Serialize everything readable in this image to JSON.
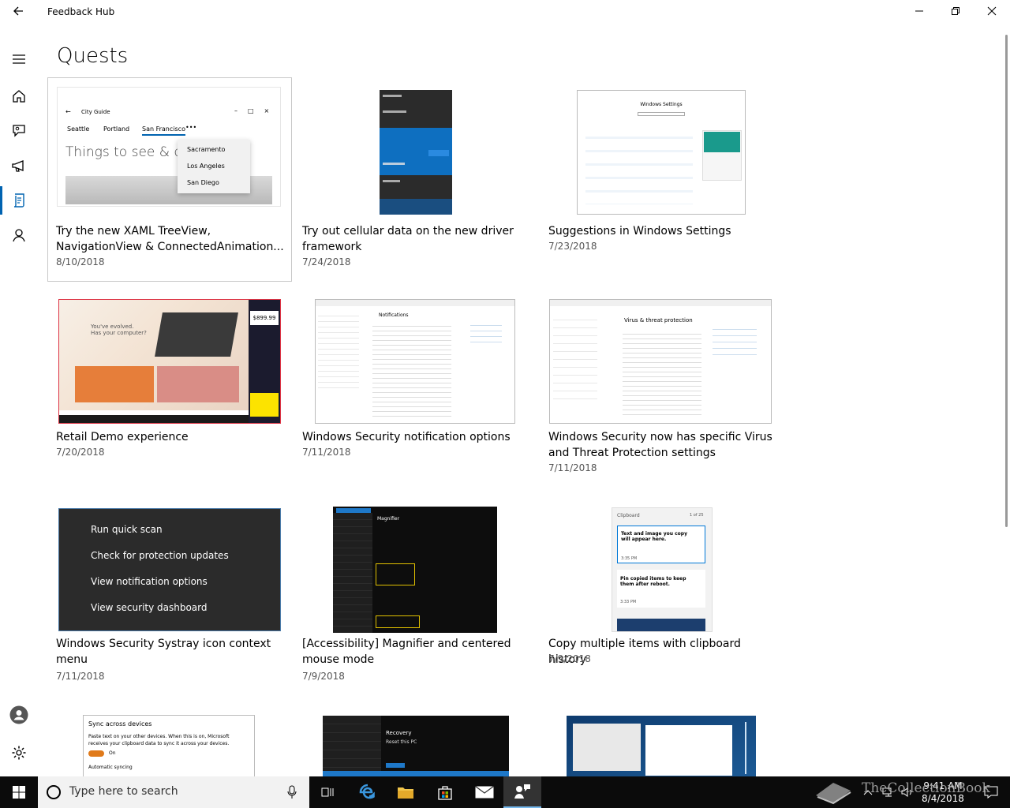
{
  "app": {
    "title": "Feedback Hub",
    "page_title": "Quests"
  },
  "cards": [
    {
      "title": "Try the new XAML TreeView, NavigationView & ConnectedAnimation...",
      "date": "8/10/2018",
      "thumb": {
        "window_title": "City Guide",
        "tabs": [
          "Seattle",
          "Portland",
          "San Francisco"
        ],
        "headline": "Things to see & do",
        "menu": [
          "Sacramento",
          "Los Angeles",
          "San Diego"
        ]
      }
    },
    {
      "title": "Try out cellular data on the new driver framework",
      "date": "7/24/2018"
    },
    {
      "title": "Suggestions in Windows Settings",
      "date": "7/23/2018",
      "thumb": {
        "heading": "Windows Settings"
      }
    },
    {
      "title": "Retail Demo experience",
      "date": "7/20/2018",
      "thumb": {
        "price": "$899.99",
        "tagline1": "You've evolved.",
        "tagline2": "Has your computer?"
      }
    },
    {
      "title": "Windows Security notification options",
      "date": "7/11/2018",
      "thumb": {
        "heading": "Notifications"
      }
    },
    {
      "title": "Windows Security now has specific Virus and Threat Protection settings",
      "date": "7/11/2018",
      "thumb": {
        "heading": "Virus & threat protection"
      }
    },
    {
      "title": "Windows Security Systray icon context menu",
      "date": "7/11/2018",
      "thumb": {
        "menu": [
          "Run quick scan",
          "Check for protection updates",
          "View notification options",
          "View security dashboard"
        ]
      }
    },
    {
      "title": " [Accessibility] Magnifier and centered mouse mode",
      "date": "7/9/2018",
      "thumb": {
        "heading": "Magnifier"
      }
    },
    {
      "title": "Copy multiple items with clipboard history",
      "date": "7/9/2018",
      "thumb": {
        "label": "Clipboard",
        "count": "1 of 25",
        "item1": "Text and image you copy will appear here.",
        "time1": "3:35 PM",
        "item2": "Pin copied items to keep them after reboot.",
        "time2": "3:33 PM"
      }
    },
    {
      "title": "",
      "date": "",
      "thumb": {
        "heading": "Sync across devices",
        "body": "Paste text on your other devices. When this is on, Microsoft receives your clipboard data to sync it across your devices.",
        "toggle": "On",
        "sub": "Automatic syncing"
      }
    },
    {
      "title": "",
      "date": "",
      "thumb": {
        "heading": "Recovery",
        "sub": "Reset this PC"
      }
    },
    {
      "title": "",
      "date": ""
    }
  ],
  "taskbar": {
    "search_placeholder": "Type here to search",
    "time": "9:41 AM",
    "date": "8/4/2018"
  },
  "watermark": "TheCollectionBook"
}
